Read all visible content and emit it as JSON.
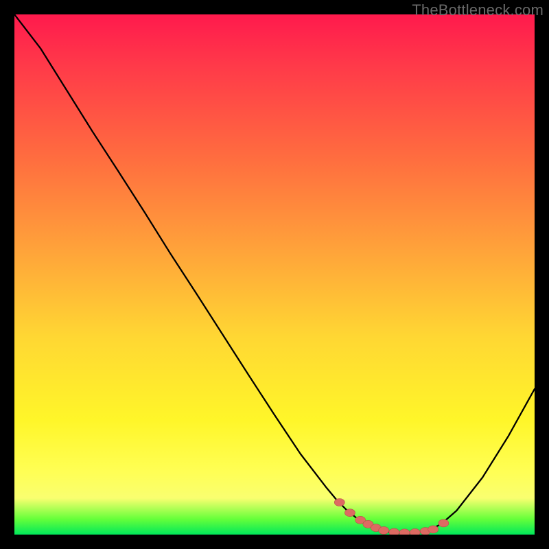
{
  "watermark": "TheBottleneck.com",
  "colors": {
    "page_bg": "#000000",
    "gradient_top": "#ff1a4d",
    "gradient_bottom": "#00e85a",
    "curve": "#000000",
    "marker_fill": "#dd6a62",
    "marker_stroke": "#b84f49"
  },
  "chart_data": {
    "type": "line",
    "title": "",
    "xlabel": "",
    "ylabel": "",
    "xlim": [
      0,
      100
    ],
    "ylim": [
      0,
      100
    ],
    "grid": false,
    "series": [
      {
        "name": "bottleneck-curve",
        "x": [
          0,
          5,
          10,
          15,
          20,
          25,
          30,
          35,
          40,
          45,
          50,
          55,
          60,
          62,
          64,
          66,
          68,
          70,
          72,
          74,
          76,
          78,
          80,
          82,
          85,
          90,
          95,
          100
        ],
        "y": [
          100,
          93.5,
          85.5,
          77.5,
          69.8,
          62,
          54,
          46.3,
          38.5,
          30.7,
          23,
          15.5,
          9,
          6.6,
          4.6,
          3,
          1.8,
          1,
          0.5,
          0.3,
          0.3,
          0.5,
          1,
          2,
          4.6,
          11,
          19,
          28
        ]
      }
    ],
    "markers": {
      "name": "flat-region-dots",
      "x": [
        62.5,
        64.5,
        66.5,
        68,
        69.5,
        71,
        73,
        75,
        77,
        79,
        80.5,
        82.5
      ],
      "y": [
        6.2,
        4.2,
        2.8,
        2,
        1.3,
        0.8,
        0.45,
        0.35,
        0.4,
        0.65,
        1.0,
        2.2
      ]
    }
  }
}
